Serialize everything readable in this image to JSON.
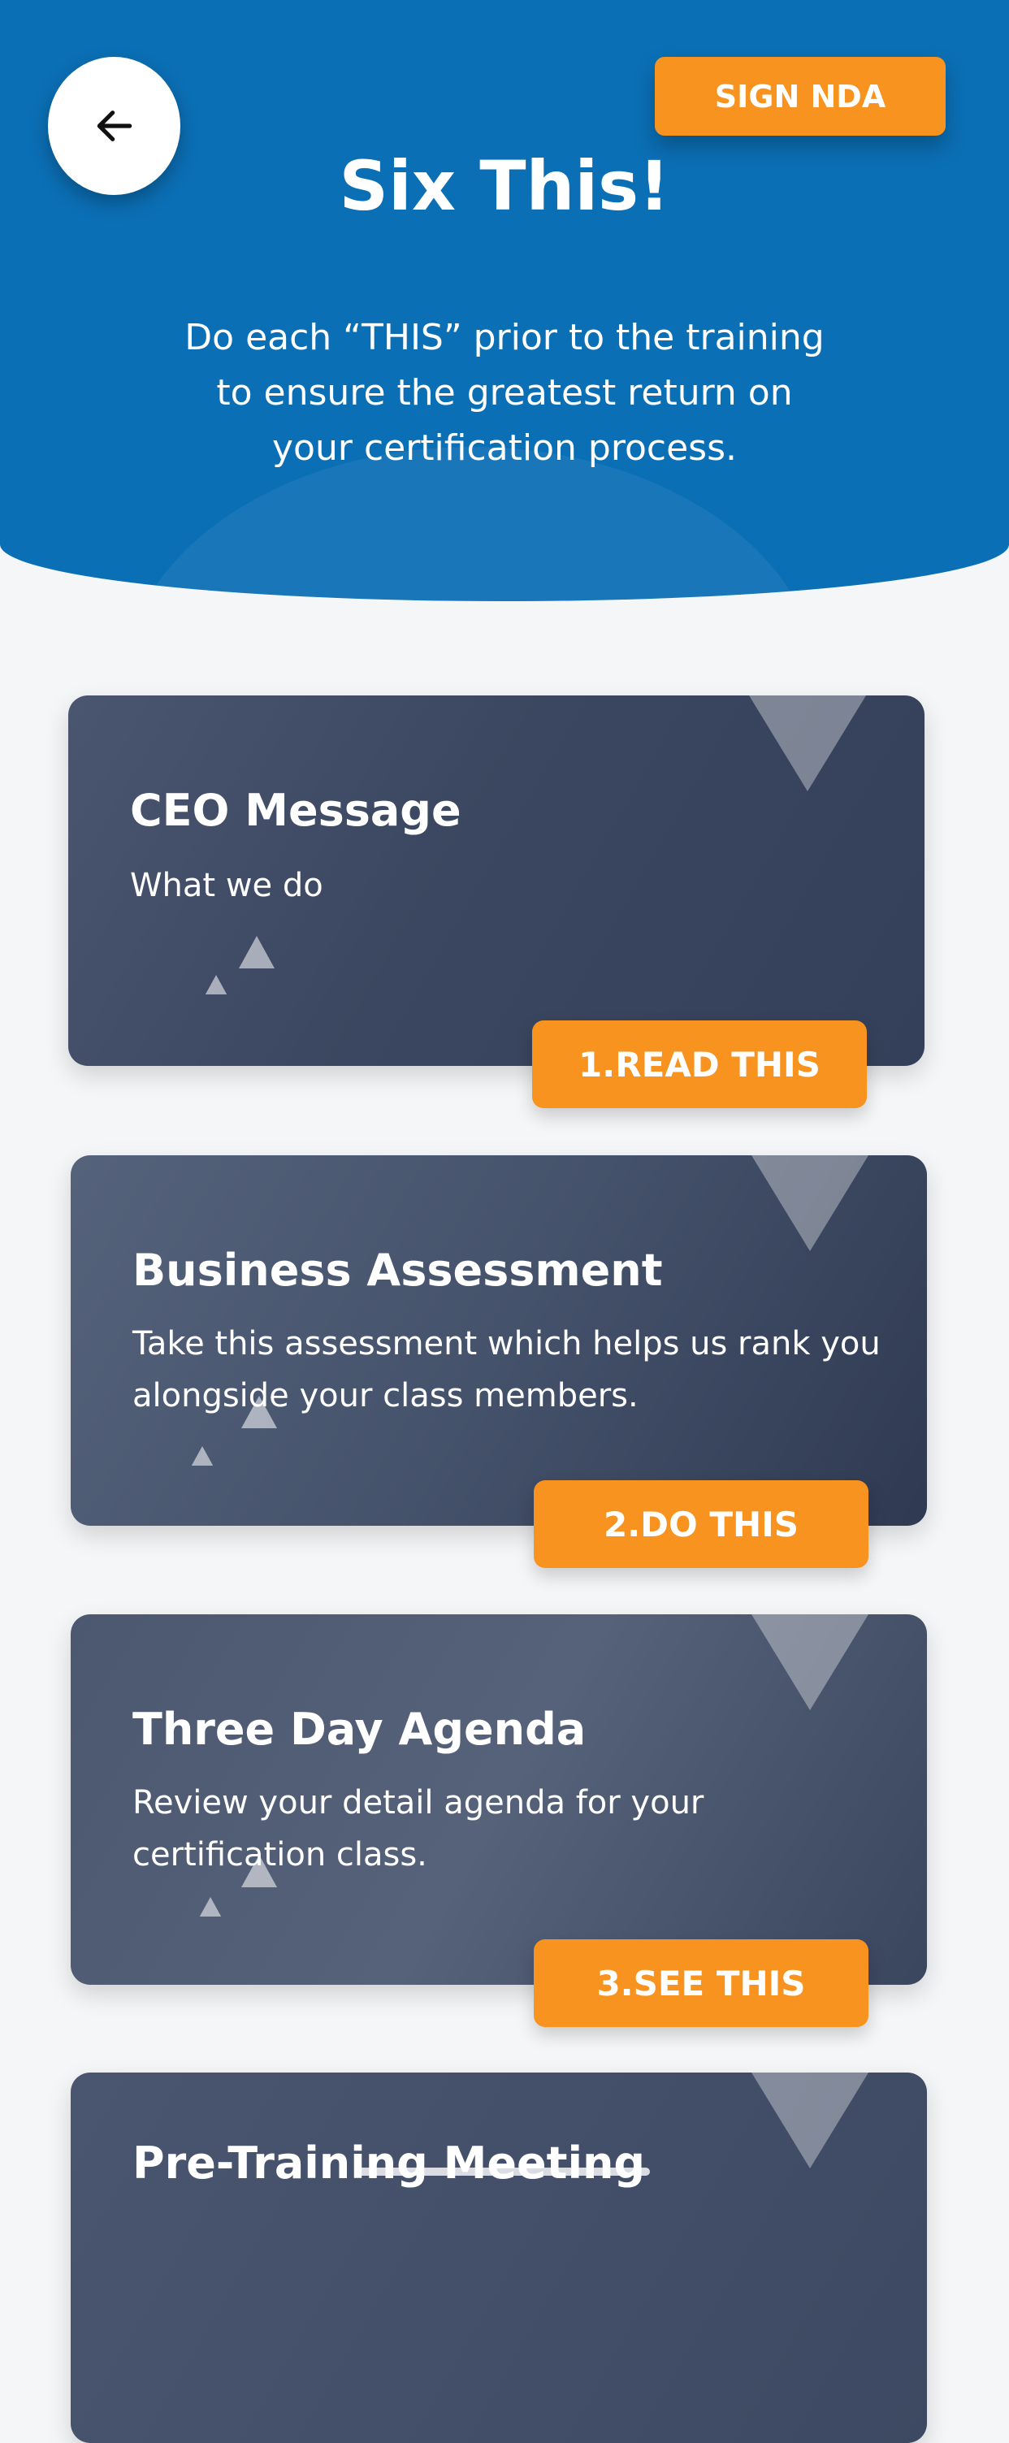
{
  "header": {
    "title": "Six This!",
    "subtitle": "Do each “THIS” prior to the training to ensure the greatest return on your certification process.",
    "sign_nda_label": "SIGN NDA",
    "back_icon": "arrow-left-icon"
  },
  "cards": [
    {
      "title": "CEO Message",
      "description": "What we do",
      "action_label": "1.READ THIS"
    },
    {
      "title": "Business Assessment",
      "description": "Take this assessment which helps us rank you alongside your class  members.",
      "action_label": "2.DO THIS"
    },
    {
      "title": "Three Day Agenda",
      "description": "Review your detail agenda for your certification class.",
      "action_label": "3.SEE THIS"
    },
    {
      "title": "Pre-Training Meeting"
    }
  ],
  "colors": {
    "header_blue": "#0b6fb5",
    "accent_orange": "#f7931e",
    "card_overlay": "#3e4a63"
  }
}
